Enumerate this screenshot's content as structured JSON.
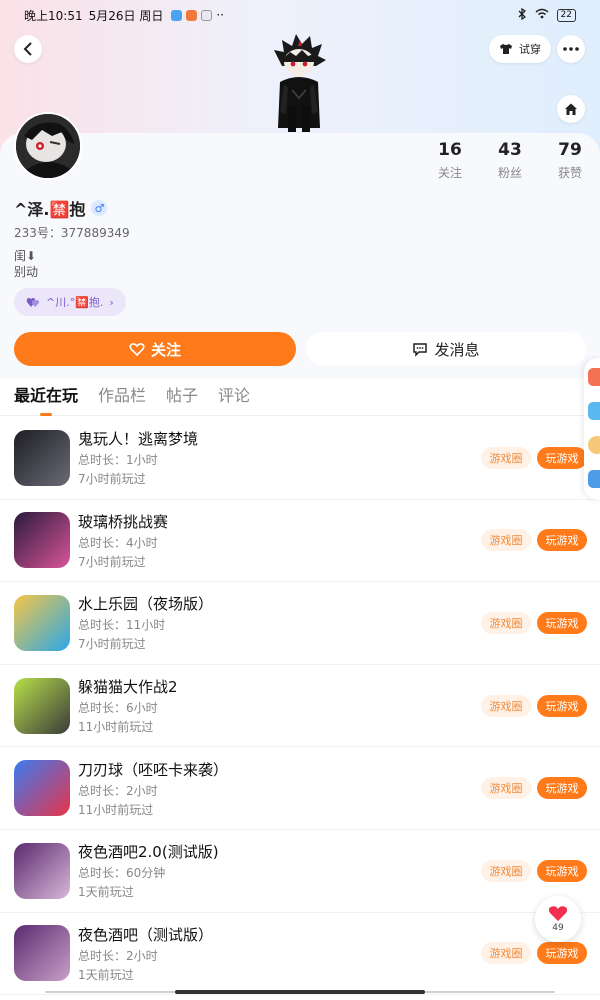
{
  "status_bar": {
    "time": "晚上10:51",
    "date": "5月26日 周日",
    "more": "··",
    "battery": "22"
  },
  "header": {
    "tryon_label": "试穿"
  },
  "profile": {
    "username": "^泽.🈲抱",
    "gender": "♂",
    "user_id": "233号：377889349",
    "bio_line1": "闺⬇",
    "bio_line2": "别动",
    "fan_tag": "^川.°🈲抱.",
    "stats": [
      {
        "num": "16",
        "label": "关注"
      },
      {
        "num": "43",
        "label": "粉丝"
      },
      {
        "num": "79",
        "label": "获赞"
      }
    ],
    "follow_label": "关注",
    "message_label": "发消息"
  },
  "tabs": [
    "最近在玩",
    "作品栏",
    "帖子",
    "评论"
  ],
  "games": [
    {
      "title": "鬼玩人！逃离梦境",
      "duration": "总时长：1小时",
      "last_played": "7小时前玩过",
      "color1": "#1d1d22",
      "color2": "#6b6b78"
    },
    {
      "title": "玻璃桥挑战赛",
      "duration": "总时长：4小时",
      "last_played": "7小时前玩过",
      "color1": "#2b1a3c",
      "color2": "#d9559a"
    },
    {
      "title": "水上乐园（夜场版）",
      "duration": "总时长：11小时",
      "last_played": "7小时前玩过",
      "color1": "#f6c646",
      "color2": "#2aa8e8"
    },
    {
      "title": "躲猫猫大作战2",
      "duration": "总时长：6小时",
      "last_played": "11小时前玩过",
      "color1": "#b7e04a",
      "color2": "#3b3b3b"
    },
    {
      "title": "刀刃球（呸呸卡来袭）",
      "duration": "总时长：2小时",
      "last_played": "11小时前玩过",
      "color1": "#3a7bf0",
      "color2": "#e8344a"
    },
    {
      "title": "夜色酒吧2.0(测试版)",
      "duration": "总时长：60分钟",
      "last_played": "1天前玩过",
      "color1": "#5a2a6e",
      "color2": "#d8b8d8"
    },
    {
      "title": "夜色酒吧（测试版）",
      "duration": "总时长：2小时",
      "last_played": "1天前玩过",
      "color1": "#5a2a6e",
      "color2": "#c9a0c9"
    }
  ],
  "game_buttons": {
    "circle": "游戏圈",
    "play": "玩游戏"
  },
  "like_float": {
    "count": "49"
  },
  "colors": {
    "accent": "#ff7a1a",
    "accent_light": "#fff1e6"
  }
}
